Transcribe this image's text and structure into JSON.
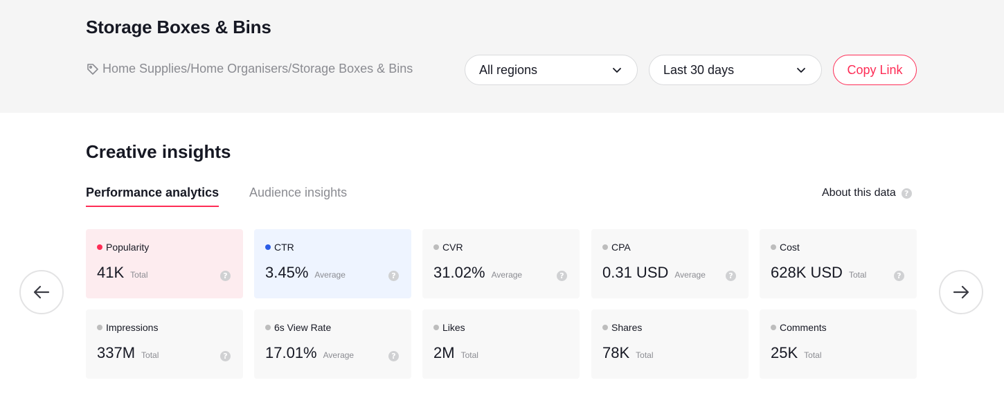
{
  "header": {
    "title": "Storage Boxes & Bins",
    "breadcrumb": "Home Supplies/Home Organisers/Storage Boxes & Bins",
    "region_select": "All regions",
    "period_select": "Last 30 days",
    "copy_link": "Copy Link"
  },
  "section": {
    "title": "Creative insights",
    "tabs": [
      "Performance analytics",
      "Audience insights"
    ],
    "active_tab": "Performance analytics",
    "about": "About this data"
  },
  "metrics": [
    {
      "label": "Popularity",
      "value": "41K",
      "sub": "Total",
      "dot": "#fe2c55",
      "help": true
    },
    {
      "label": "CTR",
      "value": "3.45%",
      "sub": "Average",
      "dot": "#2b5ce6",
      "help": true
    },
    {
      "label": "CVR",
      "value": "31.02%",
      "sub": "Average",
      "dot": "#bdbdbd",
      "help": true
    },
    {
      "label": "CPA",
      "value": "0.31 USD",
      "sub": "Average",
      "dot": "#bdbdbd",
      "help": true
    },
    {
      "label": "Cost",
      "value": "628K USD",
      "sub": "Total",
      "dot": "#bdbdbd",
      "help": true
    },
    {
      "label": "Impressions",
      "value": "337M",
      "sub": "Total",
      "dot": "#bdbdbd",
      "help": true
    },
    {
      "label": "6s View Rate",
      "value": "17.01%",
      "sub": "Average",
      "dot": "#bdbdbd",
      "help": true
    },
    {
      "label": "Likes",
      "value": "2M",
      "sub": "Total",
      "dot": "#bdbdbd",
      "help": false
    },
    {
      "label": "Shares",
      "value": "78K",
      "sub": "Total",
      "dot": "#bdbdbd",
      "help": false
    },
    {
      "label": "Comments",
      "value": "25K",
      "sub": "Total",
      "dot": "#bdbdbd",
      "help": false
    }
  ],
  "colors": {
    "accent": "#fe2c55",
    "ctr_dot": "#2b5ce6",
    "popularity_card": "#fdecef",
    "ctr_card": "#eef4ff"
  },
  "icons": {
    "breadcrumb": "tag-icon",
    "select": "chevron-down-icon",
    "help": "question-circle-icon",
    "prev": "arrow-left-icon",
    "next": "arrow-right-icon"
  }
}
